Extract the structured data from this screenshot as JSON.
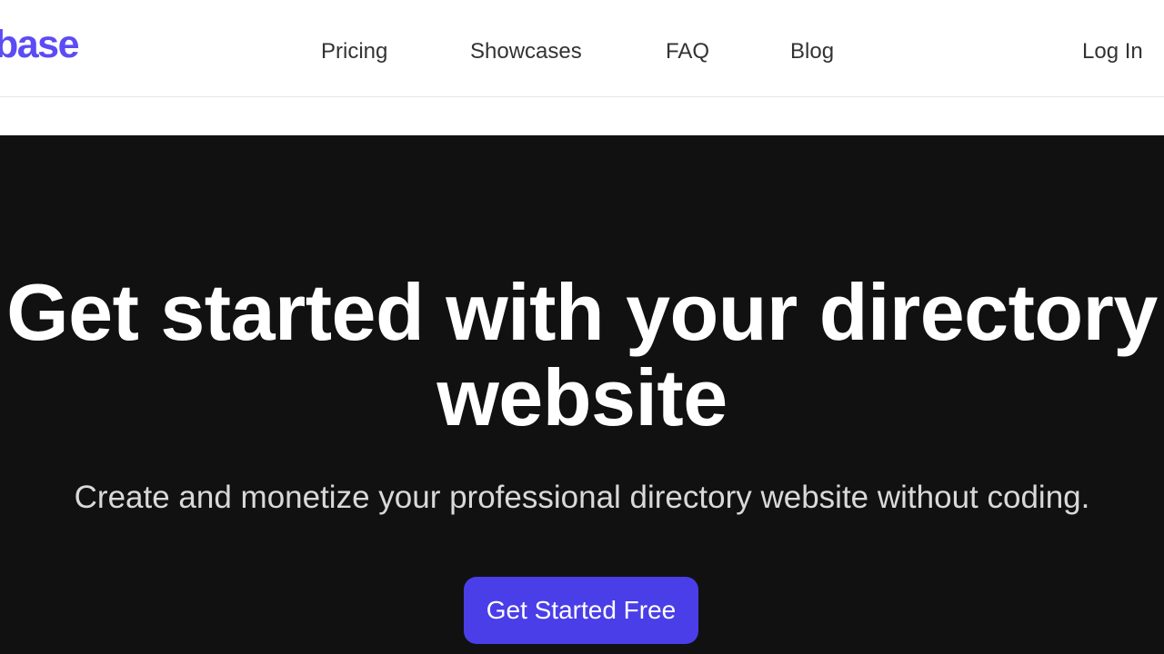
{
  "header": {
    "logo_text": "base",
    "nav": {
      "pricing": "Pricing",
      "showcases": "Showcases",
      "faq": "FAQ",
      "blog": "Blog"
    },
    "login": "Log In"
  },
  "hero": {
    "title_line1": "Get started with your directory",
    "title_line2": "website",
    "subtitle": "Create and monetize your professional directory website without coding.",
    "cta_label": "Get Started Free"
  },
  "colors": {
    "brand": "#5b4cf5",
    "cta": "#4a3ee8",
    "hero_bg": "#111111"
  }
}
